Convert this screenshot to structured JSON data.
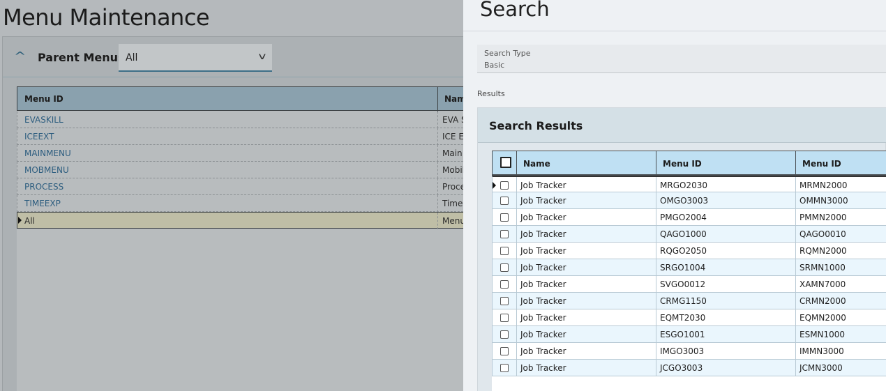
{
  "background": {
    "title": "Menu Maintenance",
    "parent_menus": {
      "label": "Parent Menus",
      "selected": "All"
    },
    "grid": {
      "columns": [
        "Menu ID",
        "Nam"
      ],
      "rows": [
        {
          "menu_id": "EVASKILL",
          "name": "EVA S"
        },
        {
          "menu_id": "ICEEXT",
          "name": "ICE Ex"
        },
        {
          "menu_id": "MAINMENU",
          "name": "Main"
        },
        {
          "menu_id": "MOBMENU",
          "name": "Mobil"
        },
        {
          "menu_id": "PROCESS",
          "name": "Proce"
        },
        {
          "menu_id": "TIMEEXP",
          "name": "Time"
        },
        {
          "menu_id": "All",
          "name": "Menu"
        }
      ]
    }
  },
  "search": {
    "title": "Search",
    "search_type_label": "Search Type",
    "search_type_value": "Basic",
    "results_label": "Results",
    "results_title": "Search Results",
    "columns": [
      "Name",
      "Menu ID",
      "Menu ID"
    ],
    "rows": [
      {
        "name": "Job Tracker",
        "menu_id": "MRGO2030",
        "parent_id": "MRMN2000"
      },
      {
        "name": "Job Tracker",
        "menu_id": "OMGO3003",
        "parent_id": "OMMN3000"
      },
      {
        "name": "Job Tracker",
        "menu_id": "PMGO2004",
        "parent_id": "PMMN2000"
      },
      {
        "name": "Job Tracker",
        "menu_id": "QAGO1000",
        "parent_id": "QAGO0010"
      },
      {
        "name": "Job Tracker",
        "menu_id": "RQGO2050",
        "parent_id": "RQMN2000"
      },
      {
        "name": "Job Tracker",
        "menu_id": "SRGO1004",
        "parent_id": "SRMN1000"
      },
      {
        "name": "Job Tracker",
        "menu_id": "SVGO0012",
        "parent_id": "XAMN7000"
      },
      {
        "name": "Job Tracker",
        "menu_id": "CRMG1150",
        "parent_id": "CRMN2000"
      },
      {
        "name": "Job Tracker",
        "menu_id": "EQMT2030",
        "parent_id": "EQMN2000"
      },
      {
        "name": "Job Tracker",
        "menu_id": "ESGO1001",
        "parent_id": "ESMN1000"
      },
      {
        "name": "Job Tracker",
        "menu_id": "IMGO3003",
        "parent_id": "IMMN3000"
      },
      {
        "name": "Job Tracker",
        "menu_id": "JCGO3003",
        "parent_id": "JCMN3000"
      }
    ]
  }
}
